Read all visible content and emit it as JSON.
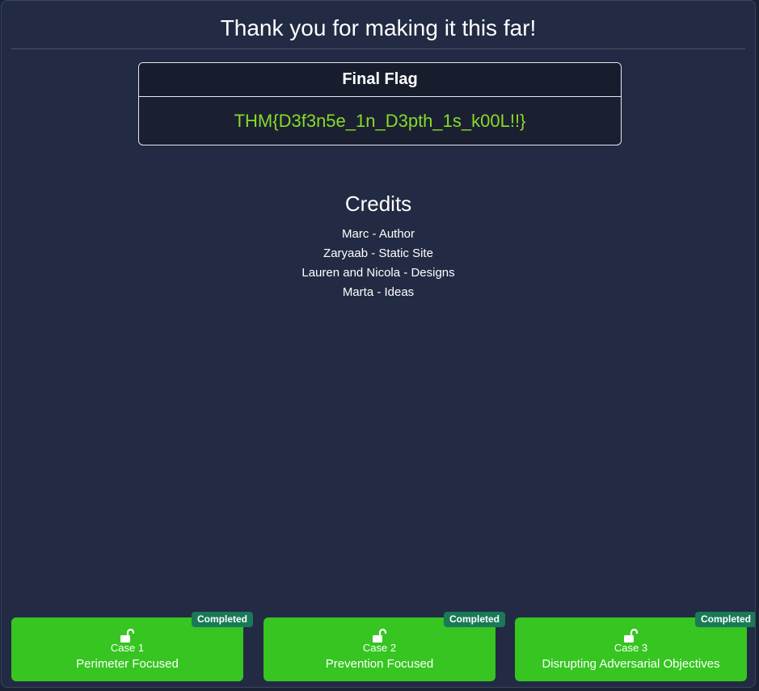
{
  "header": {
    "title": "Thank you for making it this far!"
  },
  "flag": {
    "label": "Final Flag",
    "value": "THM{D3f3n5e_1n_D3pth_1s_k00L!!}"
  },
  "credits": {
    "title": "Credits",
    "items": [
      "Marc - Author",
      "Zaryaab - Static Site",
      "Lauren and Nicola - Designs",
      "Marta - Ideas"
    ]
  },
  "cases": [
    {
      "number": "Case 1",
      "name": "Perimeter Focused",
      "status": "Completed",
      "icon": "unlock-icon"
    },
    {
      "number": "Case 2",
      "name": "Prevention Focused",
      "status": "Completed",
      "icon": "unlock-icon"
    },
    {
      "number": "Case 3",
      "name": "Disrupting Adversarial Objectives",
      "status": "Completed",
      "icon": "unlock-icon"
    }
  ],
  "colors": {
    "background": "#222b43",
    "flag_text": "#88d92a",
    "case_card": "#36c521",
    "badge": "#1a7a58"
  }
}
